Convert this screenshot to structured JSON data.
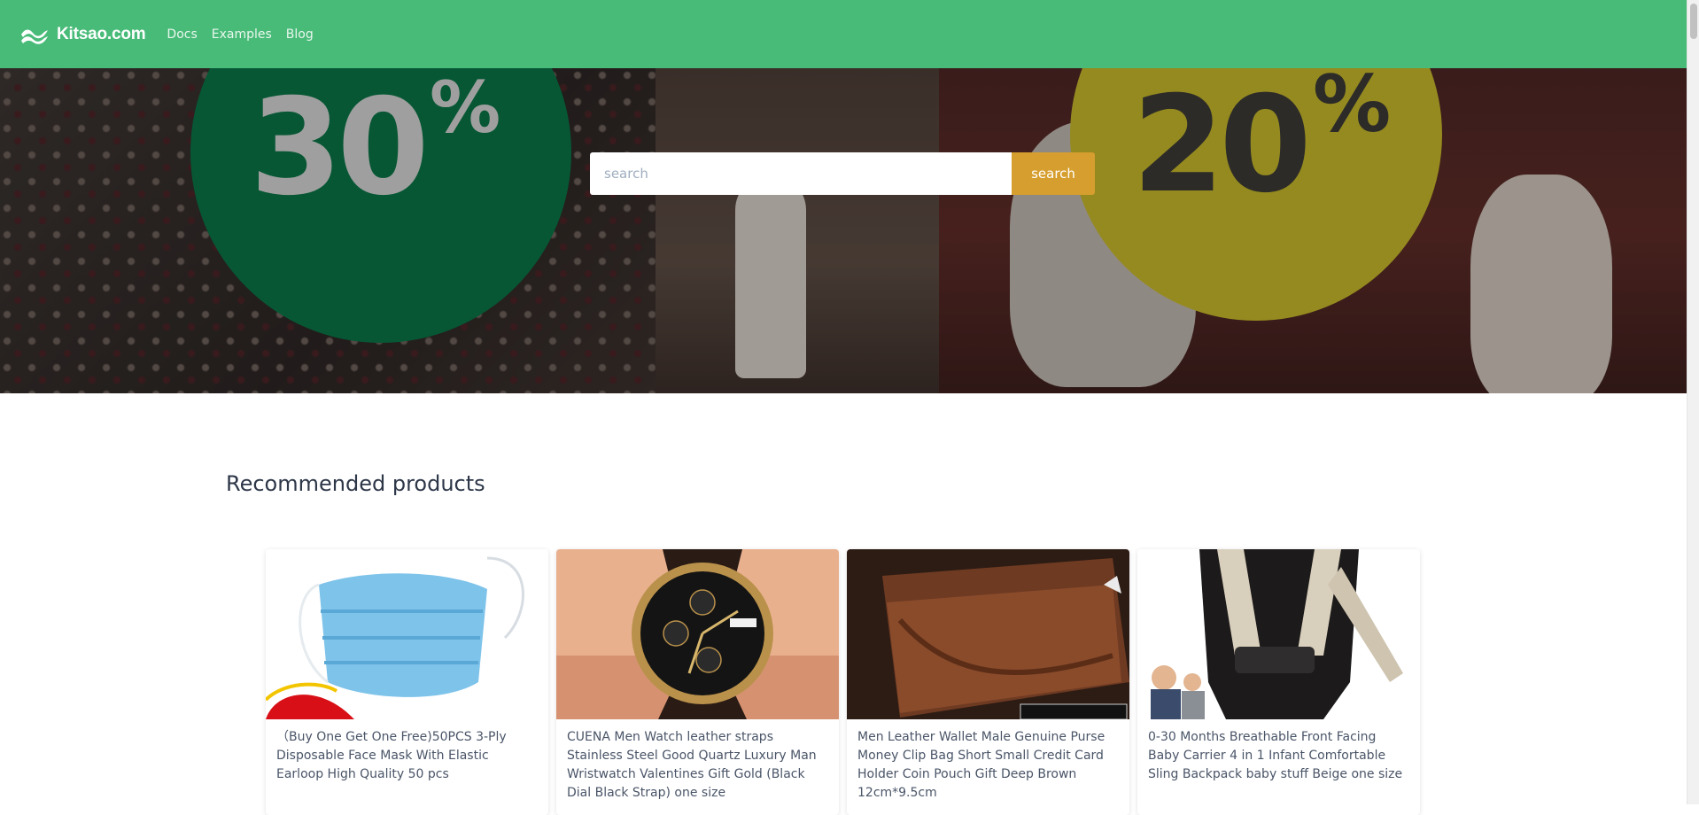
{
  "navbar": {
    "brand": "Kitsao.com",
    "links": [
      "Docs",
      "Examples",
      "Blog"
    ],
    "background_color": "#48bb78"
  },
  "hero": {
    "promo_left": {
      "value": "30",
      "suffix": "%",
      "color": "#0a7043"
    },
    "promo_right": {
      "value": "20",
      "suffix": "%",
      "color": "#bfb12a"
    },
    "search": {
      "placeholder": "search",
      "value": "",
      "button_label": "search",
      "button_color": "#d69e2e"
    }
  },
  "recommended": {
    "title": "Recommended products",
    "products": [
      {
        "title": "（Buy One Get One Free)50PCS 3-Ply Disposable Face Mask With Elastic Earloop High Quality 50 pcs",
        "image_icon": "face-mask-image"
      },
      {
        "title": "CUENA Men Watch leather straps Stainless Steel Good Quartz Luxury Man Wristwatch Valentines Gift Gold (Black Dial Black Strap) one size",
        "image_icon": "wristwatch-image"
      },
      {
        "title": "Men Leather Wallet Male Genuine Purse Money Clip Bag Short Small Credit Card Holder Coin Pouch Gift Deep Brown 12cm*9.5cm",
        "image_icon": "wallet-image"
      },
      {
        "title": "0-30 Months Breathable Front Facing Baby Carrier 4 in 1 Infant Comfortable Sling Backpack baby stuff Beige one size",
        "image_icon": "baby-carrier-image"
      }
    ]
  }
}
